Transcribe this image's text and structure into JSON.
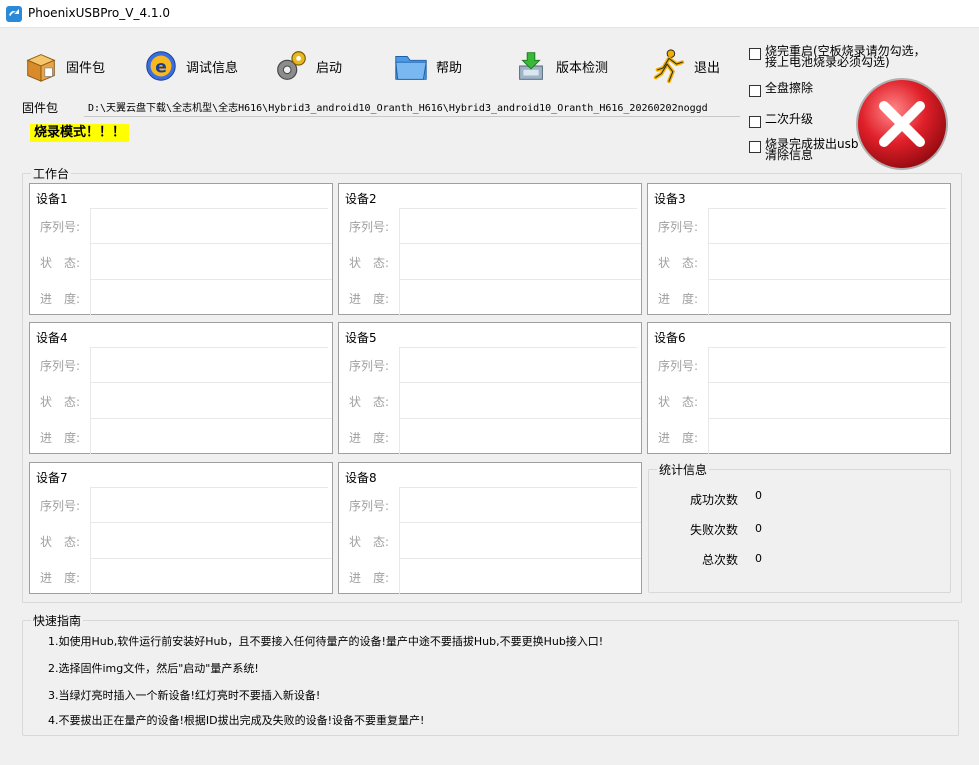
{
  "window": {
    "title": "PhoenixUSBPro_V_4.1.0"
  },
  "toolbar": {
    "firmware_label": "固件包",
    "debug_label": "调试信息",
    "start_label": "启动",
    "help_label": "帮助",
    "version_label": "版本检测",
    "exit_label": "退出"
  },
  "options": {
    "reboot_label": "烧完重启(空板烧录请勿勾选，接上电池烧录必须勾选)",
    "full_erase_label": "全盘擦除",
    "second_upgrade_label": "二次升级",
    "clear_info_label": "烧录完成拔出usb清除信息"
  },
  "firmware": {
    "label": "固件包",
    "path": "D:\\天翼云盘下载\\全志机型\\全志H616\\Hybrid3_android10_Oranth_H616\\Hybrid3_android10_Oranth_H616_20260202noggd"
  },
  "mode_banner": "烧录模式！！！",
  "workbench": {
    "title": "工作台",
    "serial_label": "序列号:",
    "status_label": "状　态:",
    "progress_label": "进　度:",
    "devices": [
      "设备1",
      "设备2",
      "设备3",
      "设备4",
      "设备5",
      "设备6",
      "设备7",
      "设备8"
    ]
  },
  "stats": {
    "title": "统计信息",
    "success_label": "成功次数",
    "success_value": "0",
    "fail_label": "失败次数",
    "fail_value": "0",
    "total_label": "总次数",
    "total_value": "0"
  },
  "guide": {
    "title": "快速指南",
    "lines": [
      "1.如使用Hub,软件运行前安装好Hub，且不要接入任何待量产的设备!量产中途不要插拔Hub,不要更换Hub接入口!",
      "2.选择固件img文件，然后\"启动\"量产系统!",
      "3.当绿灯亮时插入一个新设备!红灯亮时不要插入新设备!",
      "4.不要拔出正在量产的设备!根据ID拔出完成及失败的设备!设备不要重复量产!"
    ]
  },
  "colors": {
    "banner": "#ffff00",
    "stop_button": "#e0202a"
  }
}
